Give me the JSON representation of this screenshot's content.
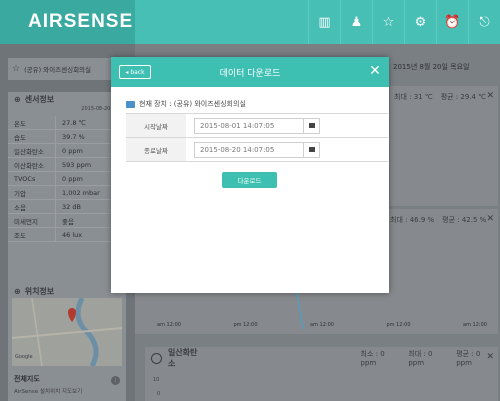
{
  "app": {
    "logo": "AIRSENSE"
  },
  "header": {
    "icons": [
      "chart-icon",
      "bell-icon",
      "star-icon",
      "gear-icon",
      "alarm-icon",
      "logout-icon"
    ],
    "date_text": "2015년 8월 20일 목요일"
  },
  "sidebar": {
    "location_title": "(공유) 와이즈센싱회의실",
    "sensor_title": "센서정보",
    "sensor_updated": "2015-08-20 14:",
    "metrics": [
      {
        "name": "온도",
        "value": "27.8 ℃"
      },
      {
        "name": "습도",
        "value": "39.7 %"
      },
      {
        "name": "일산화탄소",
        "value": "0 ppm"
      },
      {
        "name": "이산화탄소",
        "value": "593 ppm"
      },
      {
        "name": "TVOCs",
        "value": "0 ppm"
      },
      {
        "name": "기압",
        "value": "1,002 mbar"
      },
      {
        "name": "소음",
        "value": "32 dB"
      },
      {
        "name": "미세먼지",
        "value": "좋음"
      },
      {
        "name": "조도",
        "value": "46 lux"
      }
    ],
    "location_info_title": "위치정보",
    "map_brand": "Google",
    "full_map_title": "전체지도",
    "full_map_sub": "AirSense 설치위치 지도보기"
  },
  "main": {
    "top_stats": {
      "max": "최대 : 31 ℃",
      "avg": "평균 : 29.4 ℃"
    },
    "mid_stats": {
      "max": "최대 : 46.9 %",
      "avg": "평균 : 42.5 %"
    },
    "co_panel": {
      "title": "일산화탄소",
      "min": "최소 : 0 ppm",
      "max": "최대 : 0 ppm",
      "avg": "평균 : 0 ppm"
    },
    "time_labels": [
      "am 12:00",
      "pm 12:00",
      "am 12:00",
      "pm 12:00",
      "am 12:00"
    ],
    "y_ticks": [
      "10",
      "0"
    ]
  },
  "modal": {
    "back_label": "back",
    "title": "데이터 다운로드",
    "device_label": "현재 장치 : (공유) 와이즈센싱회의실",
    "start_label": "시작날짜",
    "start_value": "2015-08-01 14:07:05",
    "end_label": "종료날짜",
    "end_value": "2015-08-20 14:07:05",
    "download_label": "다운로드"
  }
}
